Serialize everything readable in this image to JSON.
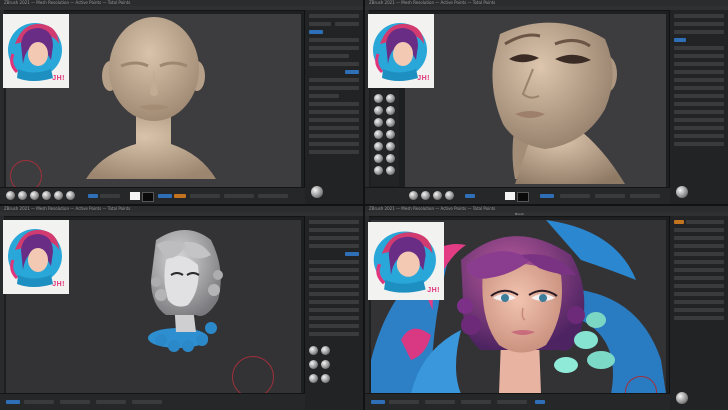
{
  "app": {
    "menu_text": "ZBrush 2021 — Mesh Resolution — Active Points — Total Points",
    "top_header_center": "Brush"
  },
  "reference": {
    "label": "JH!"
  },
  "panes": [
    {
      "id": "tl",
      "stage": "base head",
      "toolbar_button": "Draw"
    },
    {
      "id": "tr",
      "stage": "refined face",
      "toolbar_button": "Draw"
    },
    {
      "id": "bl",
      "stage": "hair blockout",
      "toolbar_button": "Draw"
    },
    {
      "id": "br",
      "stage": "polypaint",
      "toolbar_button": "Draw"
    }
  ],
  "colors": {
    "accent_blue": "#2f6fb8",
    "accent_orange": "#c4731f",
    "viewport_gray": "#3d3d3f",
    "ref_magenta": "#e0357a"
  },
  "icons": [
    "sphere-brush-icon",
    "gizmo-icon",
    "material-sphere-icon"
  ]
}
